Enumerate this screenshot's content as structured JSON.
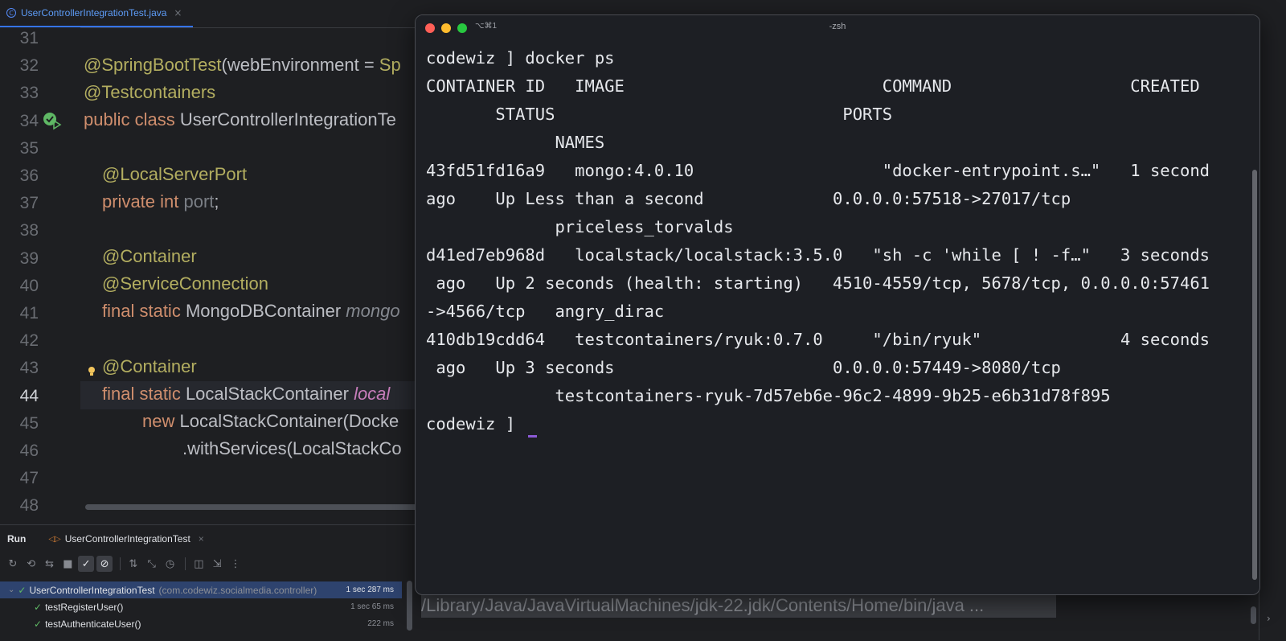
{
  "ide": {
    "file_tab": {
      "label": "UserControllerIntegrationTest.java",
      "close": "×"
    },
    "line_numbers": [
      "31",
      "32",
      "33",
      "34",
      "35",
      "36",
      "37",
      "38",
      "39",
      "40",
      "41",
      "42",
      "43",
      "44",
      "45",
      "46",
      "47",
      "48"
    ],
    "code": {
      "l32": {
        "ann": "@SpringBootTest",
        "rest": "(webEnvironment = ",
        "tail": "Sp"
      },
      "l33": {
        "ann": "@Testcontainers"
      },
      "l34": {
        "kw": "public class ",
        "name": "UserControllerIntegrationTe"
      },
      "l36": {
        "ann": "@LocalServerPort"
      },
      "l37": {
        "kw": "private int ",
        "var": "port",
        "end": ";"
      },
      "l39": {
        "ann": "@Container"
      },
      "l40": {
        "ann": "@ServiceConnection"
      },
      "l41": {
        "kw": "final static ",
        "type": "MongoDBContainer ",
        "var": "mongo"
      },
      "l43": {
        "ann": "@Container"
      },
      "l44": {
        "kw": "final static ",
        "type": "LocalStackContainer ",
        "var": "local"
      },
      "l45": {
        "kw": "new ",
        "rest": "LocalStackContainer(Docke"
      },
      "l46": {
        "rest": ".withServices(LocalStackCo"
      }
    },
    "run_panel": {
      "run_label": "Run",
      "tab_label": "UserControllerIntegrationTest",
      "tab_close": "×",
      "tree": [
        {
          "name": "UserControllerIntegrationTest",
          "package": "(com.codewiz.socialmedia.controller)",
          "time": "1 sec 287 ms",
          "selected": true
        },
        {
          "name": "testRegisterUser()",
          "time": "1 sec 65 ms"
        },
        {
          "name": "testAuthenticateUser()",
          "time": "222 ms"
        }
      ]
    },
    "console_line": "/Library/Java/JavaVirtualMachines/jdk-22.jdk/Contents/Home/bin/java ...",
    "colors": {
      "accent": "#3574f0",
      "pass": "#5fb865",
      "annotation": "#b3ae60",
      "keyword": "#cf8e6d"
    }
  },
  "terminal": {
    "shortcut": "⌥⌘1",
    "title": "-zsh",
    "lines": [
      "codewiz ] docker ps",
      "CONTAINER ID   IMAGE                          COMMAND                  CREATED",
      "       STATUS                             PORTS",
      "             NAMES",
      "43fd51fd16a9   mongo:4.0.10                   \"docker-entrypoint.s…\"   1 second",
      "ago    Up Less than a second             0.0.0.0:57518->27017/tcp",
      "             priceless_torvalds",
      "d41ed7eb968d   localstack/localstack:3.5.0   \"sh -c 'while [ ! -f…\"   3 seconds",
      " ago   Up 2 seconds (health: starting)   4510-4559/tcp, 5678/tcp, 0.0.0.0:57461",
      "->4566/tcp   angry_dirac",
      "410db19cdd64   testcontainers/ryuk:0.7.0     \"/bin/ryuk\"              4 seconds",
      " ago   Up 3 seconds                      0.0.0.0:57449->8080/tcp",
      "             testcontainers-ryuk-7d57eb6e-96c2-4899-9b25-e6b31d78f895"
    ],
    "prompt": "codewiz ] "
  }
}
